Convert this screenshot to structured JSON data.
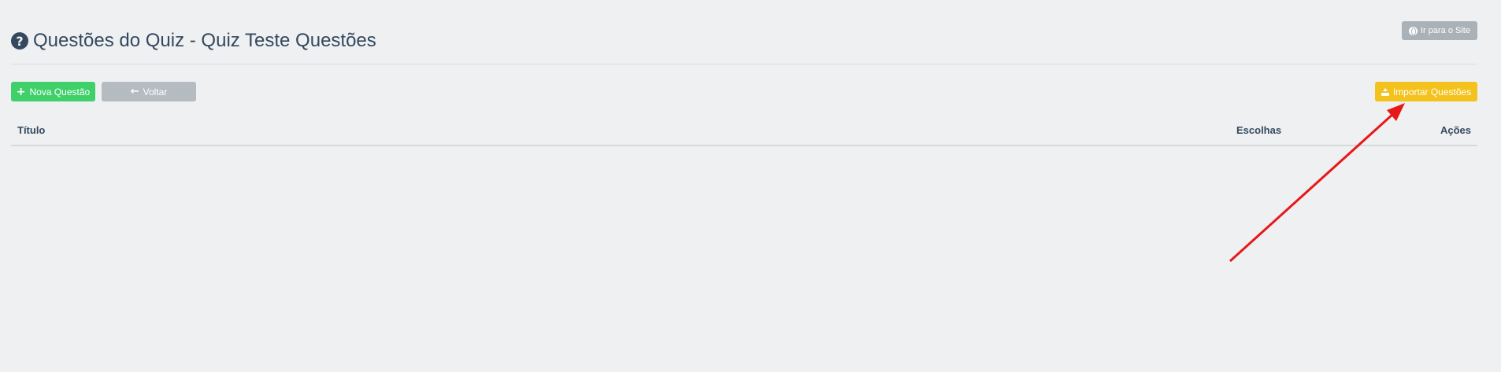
{
  "header": {
    "site_button_label": "Ir para o Site",
    "page_title": "Questões do Quiz - Quiz Teste Questões"
  },
  "toolbar": {
    "new_question_label": "Nova Questão",
    "back_label": "Voltar",
    "import_label": "Importar Questões"
  },
  "table": {
    "columns": [
      "Título",
      "Escolhas",
      "Ações"
    ]
  },
  "icons": {
    "site": "globe-icon",
    "title": "question-circle-icon",
    "new": "plus-icon",
    "back": "arrow-left-icon",
    "import": "upload-icon"
  },
  "colors": {
    "background": "#eef0f2",
    "text": "#34495e",
    "new_button": "#3fd06a",
    "back_button": "#b4bcc1",
    "import_button": "#f4c21c",
    "site_button": "#aab2b8",
    "annotation_arrow": "#e81818"
  }
}
